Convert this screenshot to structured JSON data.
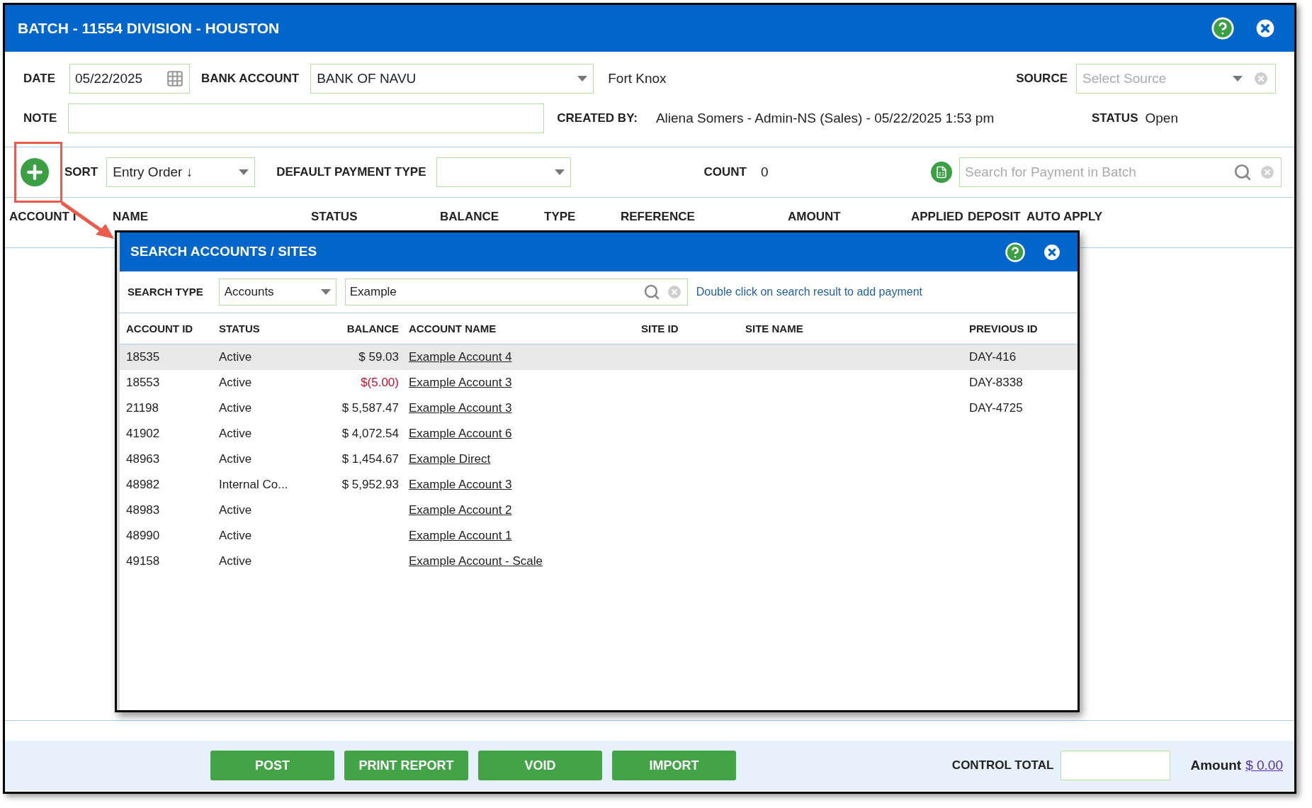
{
  "window": {
    "title": "BATCH - 11554 DIVISION - HOUSTON"
  },
  "form": {
    "date": {
      "label": "DATE",
      "value": "05/22/2025"
    },
    "bank_account": {
      "label": "BANK ACCOUNT",
      "value": "BANK OF NAVU"
    },
    "bank_name": "Fort Knox",
    "source": {
      "label": "SOURCE",
      "placeholder": "Select Source"
    },
    "note": {
      "label": "NOTE"
    },
    "created_by": {
      "label": "CREATED BY:",
      "value": "Aliena Somers - Admin-NS (Sales) - 05/22/2025 1:53 pm"
    },
    "status": {
      "label": "STATUS",
      "value": "Open"
    }
  },
  "toolbar": {
    "sort": {
      "label": "SORT",
      "value": "Entry Order ↓"
    },
    "default_payment_type": {
      "label": "DEFAULT PAYMENT TYPE"
    },
    "count": {
      "label": "COUNT",
      "value": "0"
    },
    "search": {
      "placeholder": "Search for Payment in Batch"
    }
  },
  "table": {
    "columns": [
      "ACCOUNT I",
      "NAME",
      "STATUS",
      "BALANCE",
      "TYPE",
      "REFERENCE",
      "AMOUNT",
      "APPLIED",
      "DEPOSIT",
      "AUTO APPLY"
    ]
  },
  "dialog": {
    "title": "SEARCH ACCOUNTS / SITES",
    "search_type": {
      "label": "SEARCH TYPE",
      "value": "Accounts"
    },
    "search": {
      "value": "Example"
    },
    "hint": "Double click on search result to add payment",
    "columns": [
      "ACCOUNT ID",
      "STATUS",
      "BALANCE",
      "ACCOUNT NAME",
      "SITE ID",
      "SITE NAME",
      "PREVIOUS ID"
    ],
    "rows": [
      {
        "account_id": "18535",
        "status": "Active",
        "balance": "$ 59.03",
        "negative": false,
        "account_name": "Example Account 4",
        "previous_id": "DAY-416",
        "selected": true
      },
      {
        "account_id": "18553",
        "status": "Active",
        "balance": "$(5.00)",
        "negative": true,
        "account_name": "Example Account 3",
        "previous_id": "DAY-8338",
        "selected": false
      },
      {
        "account_id": "21198",
        "status": "Active",
        "balance": "$ 5,587.47",
        "negative": false,
        "account_name": "Example Account 3",
        "previous_id": "DAY-4725",
        "selected": false
      },
      {
        "account_id": "41902",
        "status": "Active",
        "balance": "$ 4,072.54",
        "negative": false,
        "account_name": "Example Account 6",
        "selected": false
      },
      {
        "account_id": "48963",
        "status": "Active",
        "balance": "$ 1,454.67",
        "negative": false,
        "account_name": "Example Direct",
        "selected": false
      },
      {
        "account_id": "48982",
        "status": "Internal Co...",
        "balance": "$ 5,952.93",
        "negative": false,
        "account_name": "Example Account 3",
        "selected": false
      },
      {
        "account_id": "48983",
        "status": "Active",
        "account_name": "Example Account 2",
        "selected": false
      },
      {
        "account_id": "48990",
        "status": "Active",
        "account_name": "Example Account 1",
        "selected": false
      },
      {
        "account_id": "49158",
        "status": "Active",
        "account_name": "Example Account - Scale",
        "selected": false
      }
    ]
  },
  "footer": {
    "buttons": [
      "POST",
      "PRINT REPORT",
      "VOID",
      "IMPORT"
    ],
    "control_total": {
      "label": "CONTROL TOTAL"
    },
    "amount": {
      "label": "Amount",
      "value": "$ 0.00"
    }
  }
}
